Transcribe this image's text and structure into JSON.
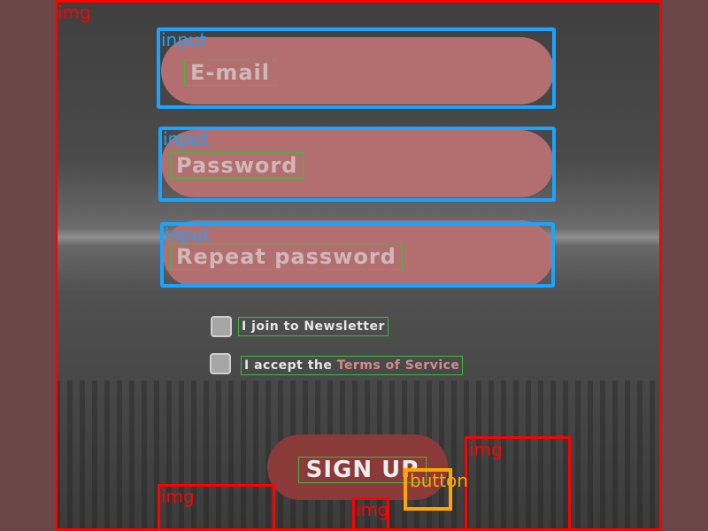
{
  "annotations": {
    "img": "img",
    "input": "input",
    "button": "button"
  },
  "form": {
    "email_placeholder": "E-mail",
    "password_placeholder": "Password",
    "repeat_password_placeholder": "Repeat password",
    "newsletter_label": "I join to Newsletter",
    "terms_prefix": "I accept the ",
    "terms_link": "Terms of Service",
    "signup_label": "SIGN UP"
  },
  "colors": {
    "field": "#b36f6f",
    "signup_button": "#8b3a3a",
    "input_outline": "#1aa3ff",
    "img_outline": "#ff0000",
    "button_outline": "#ffa500",
    "link": "#d08c8c"
  }
}
